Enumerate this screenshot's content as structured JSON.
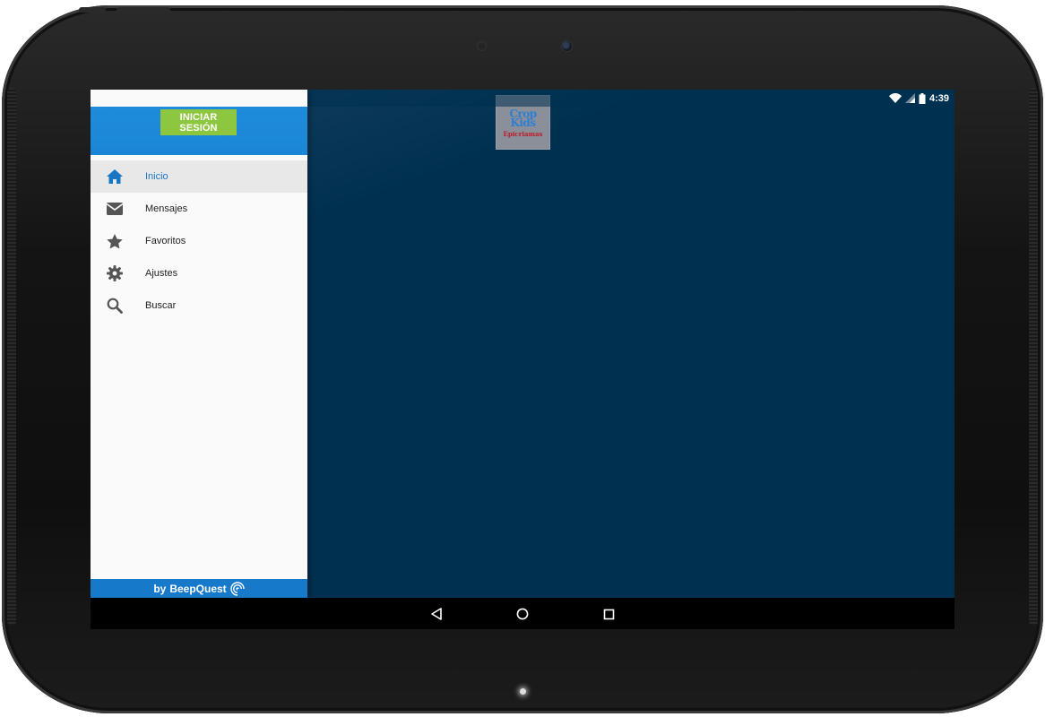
{
  "status_bar": {
    "time": "4:39",
    "icons": [
      "download-icon",
      "wifi-icon",
      "signal-icon",
      "battery-icon"
    ]
  },
  "logo": {
    "line1": "Crop",
    "line2": "Kids",
    "line3": "Epicriamas"
  },
  "drawer": {
    "login_label": "INICIAR SESIÓN",
    "items": [
      {
        "label": "Inicio",
        "icon": "home-icon",
        "active": true
      },
      {
        "label": "Mensajes",
        "icon": "envelope-icon",
        "active": false
      },
      {
        "label": "Favoritos",
        "icon": "star-icon",
        "active": false
      },
      {
        "label": "Ajustes",
        "icon": "gear-icon",
        "active": false
      },
      {
        "label": "Buscar",
        "icon": "search-icon",
        "active": false
      }
    ],
    "footer_by": "by",
    "footer_brand": "BeepQuest"
  },
  "colors": {
    "accent": "#1f8bdb",
    "login_button": "#8dc63f",
    "active_item_text": "#1976c5",
    "content_bg": "#003050"
  },
  "nav_bar": {
    "icons": [
      "back-icon",
      "home-circle-icon",
      "recents-icon"
    ]
  }
}
